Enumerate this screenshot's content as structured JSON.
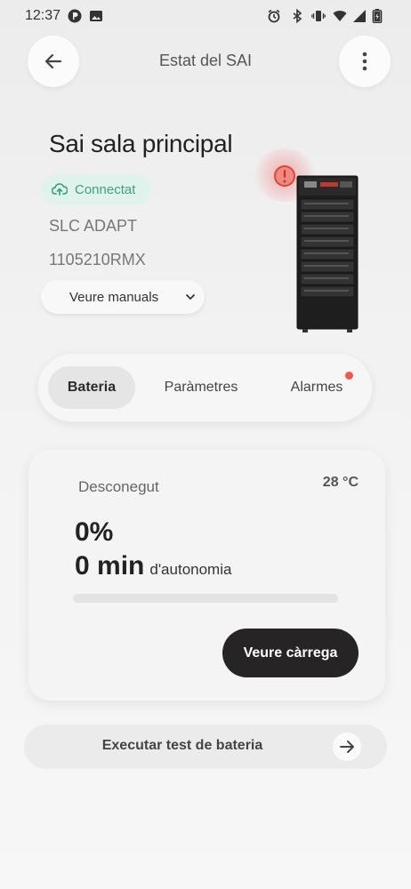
{
  "status_bar": {
    "time": "12:37",
    "left_icons": [
      "p-app-icon",
      "image-icon"
    ],
    "right_icons": [
      "alarm-icon",
      "bluetooth-icon",
      "vibrate-icon",
      "wifi-icon",
      "signal-icon",
      "battery-charging-icon"
    ]
  },
  "header": {
    "title": "Estat del SAI",
    "back_icon": "arrow-left-icon",
    "menu_icon": "more-vertical-icon"
  },
  "device": {
    "name": "Sai sala principal",
    "status": "Connectat",
    "status_icon": "cloud-upload-icon",
    "model": "SLC ADAPT",
    "serial": "1105210RMX",
    "manuals_select": "Veure manuals",
    "alert_icon": "alert-circle-icon",
    "image": "ups-tower-image"
  },
  "tabs": [
    {
      "label": "Bateria",
      "active": true
    },
    {
      "label": "Paràmetres",
      "active": false
    },
    {
      "label": "Alarmes",
      "active": false,
      "has_notification": true
    }
  ],
  "battery": {
    "state": "Desconegut",
    "temperature": "28 °C",
    "percent": "0%",
    "autonomy_value": "0 min",
    "autonomy_label": "d'autonomia",
    "charge_level": 0,
    "charge_button": "Veure càrrega"
  },
  "test_button": {
    "label": "Executar test de bateria",
    "icon": "arrow-right-icon"
  },
  "colors": {
    "accent_green": "#3aa383",
    "badge_bg": "#dff3ec",
    "alert_red": "#ef5a48",
    "dark_button": "#262424"
  }
}
